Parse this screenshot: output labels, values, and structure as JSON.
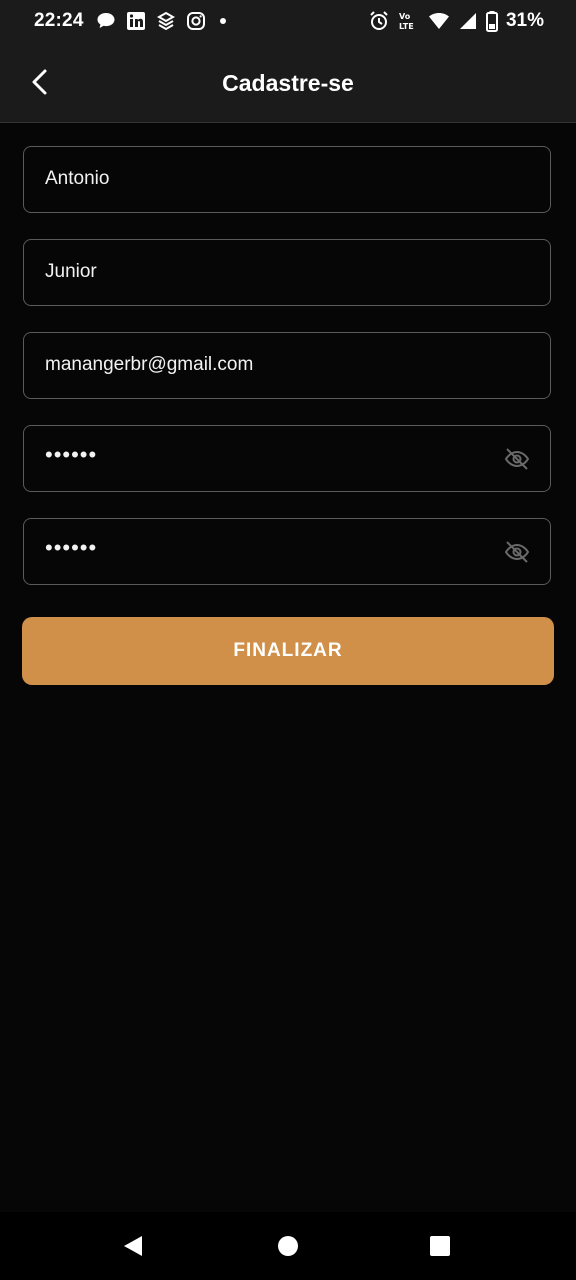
{
  "status_bar": {
    "time": "22:24",
    "battery": "31%",
    "notification_icons": [
      "chat-bubble-icon",
      "linkedin-icon",
      "layers-icon",
      "instagram-icon",
      "dot-icon"
    ],
    "system_icons": [
      "alarm-icon",
      "volte-icon",
      "wifi-icon",
      "signal-icon",
      "battery-icon"
    ]
  },
  "app_bar": {
    "title": "Cadastre-se",
    "back_icon": "chevron-left-icon"
  },
  "form": {
    "first_name": "Antonio",
    "last_name": "Junior",
    "email": "manangerbr@gmail.com",
    "password": "••••••",
    "confirm_password": "••••••",
    "visibility_icon": "eye-off-icon"
  },
  "submit_label": "FINALIZAR",
  "colors": {
    "accent": "#d0904a",
    "background": "#060606",
    "bar": "#1b1b1b",
    "field_border": "#5a5a5a"
  },
  "nav_bar": {
    "icons": [
      "back-triangle-icon",
      "home-circle-icon",
      "recents-square-icon"
    ]
  }
}
